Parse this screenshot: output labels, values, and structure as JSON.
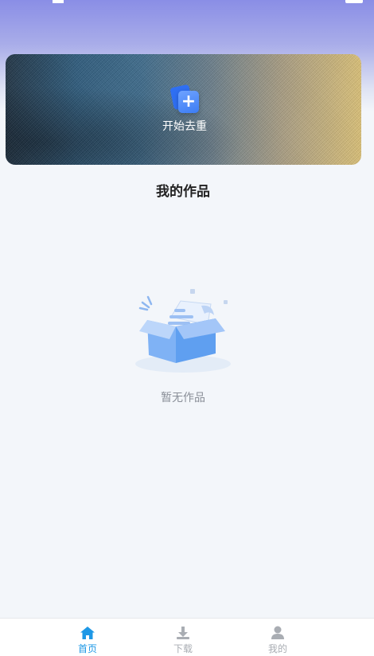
{
  "banner": {
    "start_label": "开始去重"
  },
  "works": {
    "title": "我的作品",
    "empty_text": "暂无作品"
  },
  "tabbar": {
    "items": [
      {
        "label": "首页",
        "icon": "home-icon",
        "active": true
      },
      {
        "label": "下载",
        "icon": "download-icon",
        "active": false
      },
      {
        "label": "我的",
        "icon": "user-icon",
        "active": false
      }
    ]
  },
  "colors": {
    "accent": "#1e98e6",
    "inactive": "#a9adb3",
    "header_gradient_top": "#8a8ee6",
    "background": "#f3f6fa"
  }
}
